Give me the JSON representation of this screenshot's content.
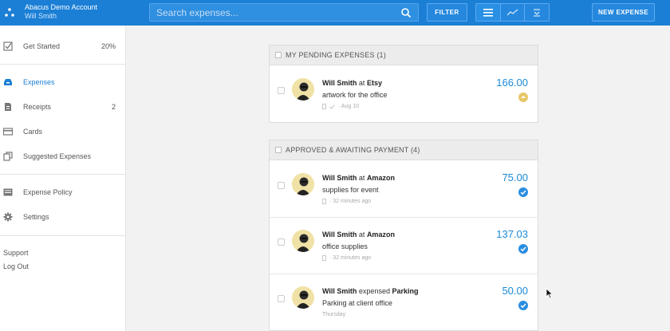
{
  "account": {
    "name": "Abacus Demo Account",
    "user": "Will Smith"
  },
  "search": {
    "placeholder": "Search expenses..."
  },
  "toolbar": {
    "filter_label": "FILTER",
    "new_expense_label": "NEW EXPENSE"
  },
  "sidebar": {
    "items": [
      {
        "label": "Get Started",
        "count": "20%",
        "icon": "checkbox-icon"
      },
      {
        "label": "Expenses",
        "count": "",
        "icon": "inbox-icon",
        "active": true
      },
      {
        "label": "Receipts",
        "count": "2",
        "icon": "document-icon"
      },
      {
        "label": "Cards",
        "count": "",
        "icon": "card-icon"
      },
      {
        "label": "Suggested Expenses",
        "count": "",
        "icon": "copy-icon"
      },
      {
        "label": "Expense Policy",
        "count": "",
        "icon": "policy-icon"
      },
      {
        "label": "Settings",
        "count": "",
        "icon": "gear-icon"
      }
    ],
    "links": {
      "support": "Support",
      "logout": "Log Out"
    }
  },
  "pending": {
    "title": "MY PENDING EXPENSES (1)",
    "rows": [
      {
        "name": "Will Smith",
        "connector": " at ",
        "merchant": "Etsy",
        "description": "artwork for the office",
        "meta": "· Aug 10",
        "amount": "166.00",
        "status": "pending"
      }
    ]
  },
  "approved": {
    "title": "APPROVED & AWAITING PAYMENT (4)",
    "rows": [
      {
        "name": "Will Smith",
        "connector": " at ",
        "merchant": "Amazon",
        "description": "supplies for event",
        "meta": "· 32 minutes ago",
        "amount": "75.00",
        "status": "approved"
      },
      {
        "name": "Will Smith",
        "connector": " at ",
        "merchant": "Amazon",
        "description": "office supplies",
        "meta": "· 32 minutes ago",
        "amount": "137.03",
        "status": "approved"
      },
      {
        "name": "Will Smith",
        "connector": " expensed ",
        "merchant": "Parking",
        "description": "Parking at client office",
        "meta": "Thursday",
        "amount": "50.00",
        "status": "approved"
      }
    ]
  },
  "colors": {
    "brand": "#1b7fd6",
    "amount": "#1b8ad6",
    "approved": "#2a8ee0",
    "pending": "#e6c76a"
  }
}
